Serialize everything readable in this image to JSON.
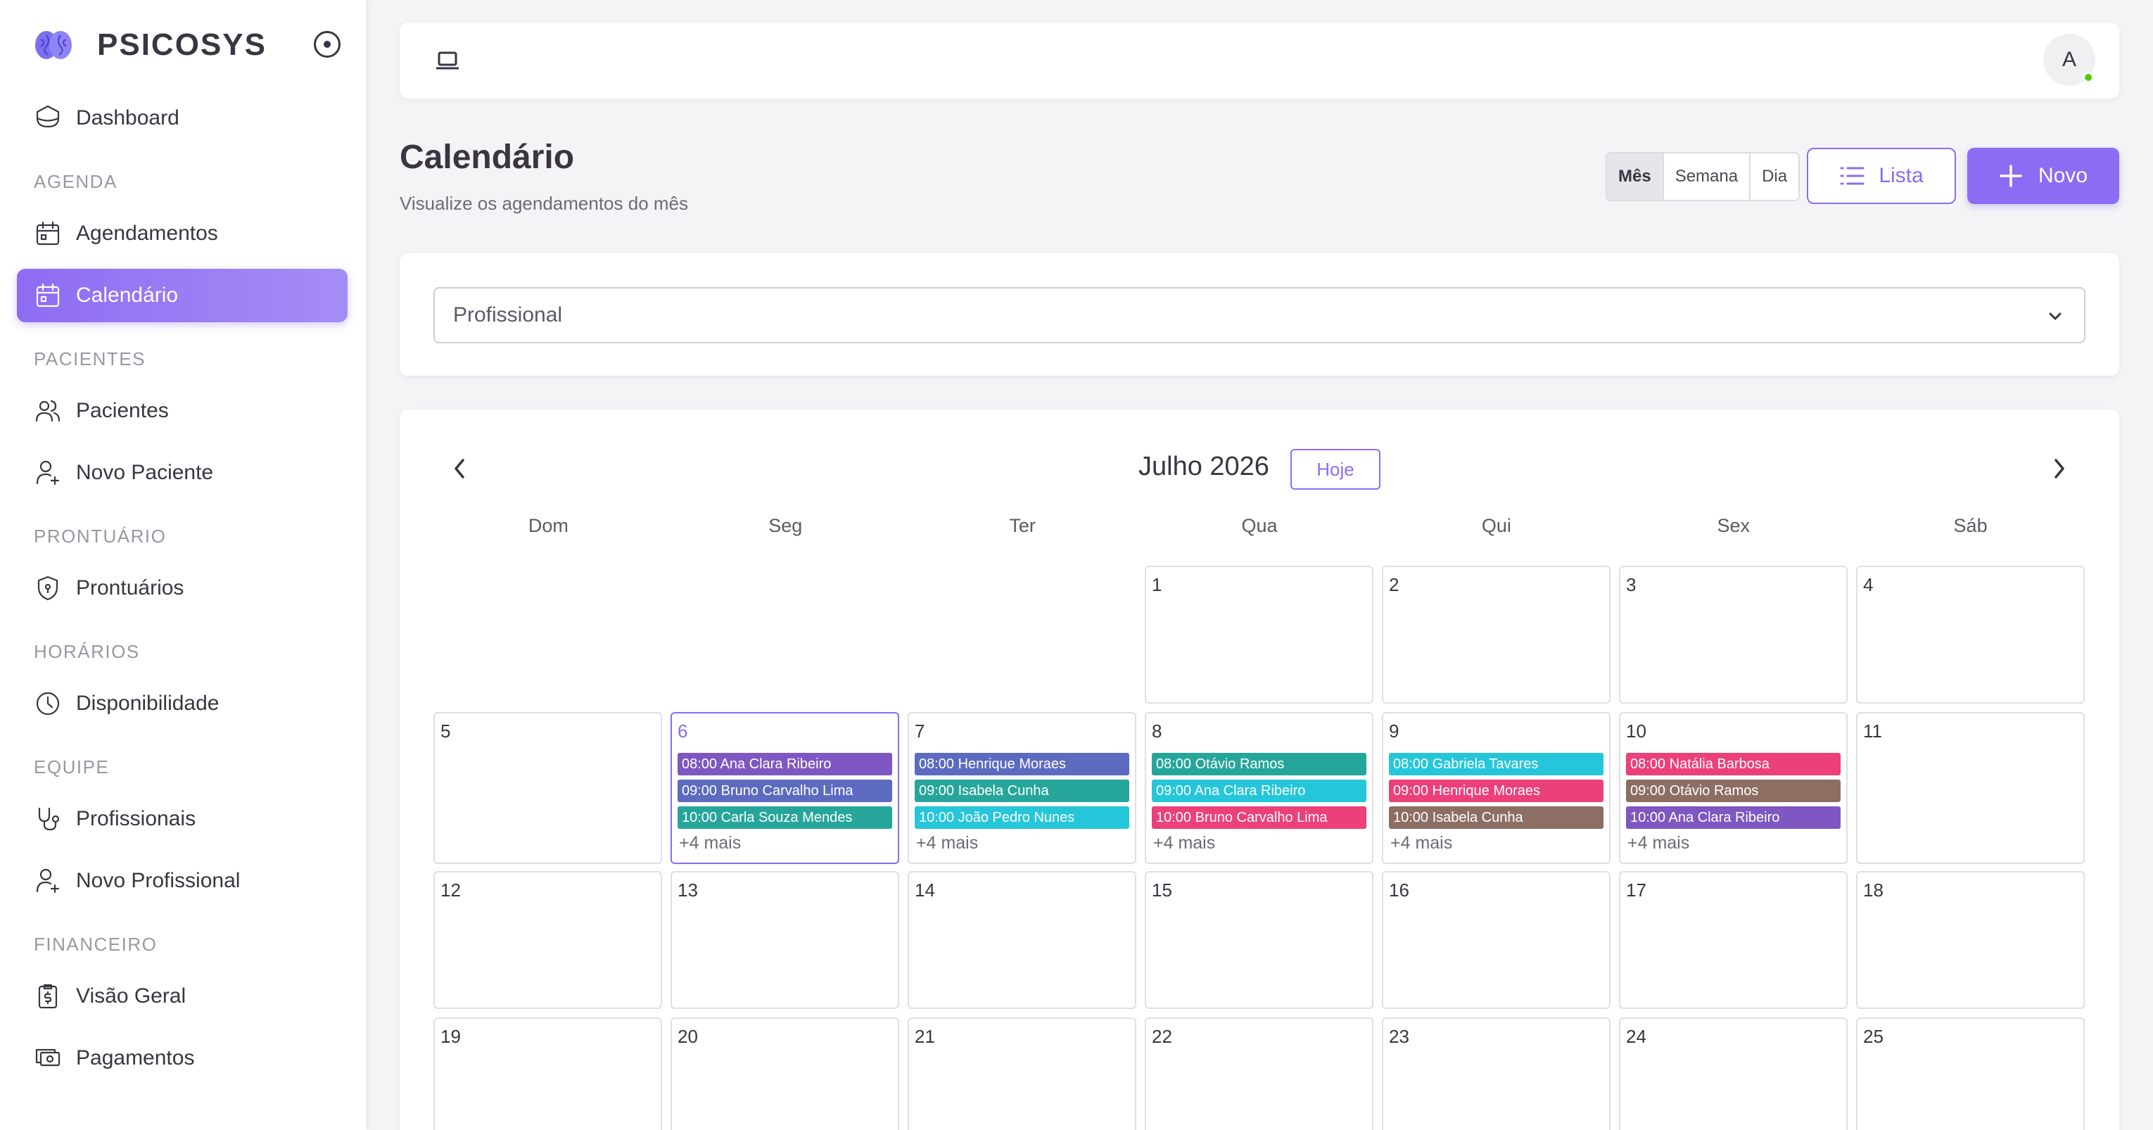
{
  "brand": {
    "name": "PSICOSYS"
  },
  "sidebar": {
    "items": [
      {
        "type": "item",
        "label": "Dashboard",
        "icon": "home-icon",
        "name": "sidebar-item-dashboard"
      },
      {
        "type": "section",
        "label": "AGENDA"
      },
      {
        "type": "item",
        "label": "Agendamentos",
        "icon": "calendar-check-icon",
        "name": "sidebar-item-agendamentos"
      },
      {
        "type": "item",
        "label": "Calendário",
        "icon": "calendar-icon",
        "name": "sidebar-item-calendario",
        "active": true
      },
      {
        "type": "section",
        "label": "PACIENTES"
      },
      {
        "type": "item",
        "label": "Pacientes",
        "icon": "users-icon",
        "name": "sidebar-item-pacientes"
      },
      {
        "type": "item",
        "label": "Novo Paciente",
        "icon": "user-plus-icon",
        "name": "sidebar-item-novo-paciente"
      },
      {
        "type": "section",
        "label": "PRONTUÁRIO"
      },
      {
        "type": "item",
        "label": "Prontuários",
        "icon": "shield-icon",
        "name": "sidebar-item-prontuarios"
      },
      {
        "type": "section",
        "label": "HORÁRIOS"
      },
      {
        "type": "item",
        "label": "Disponibilidade",
        "icon": "clock-icon",
        "name": "sidebar-item-disponibilidade"
      },
      {
        "type": "section",
        "label": "EQUIPE"
      },
      {
        "type": "item",
        "label": "Profissionais",
        "icon": "stethoscope-icon",
        "name": "sidebar-item-profissionais"
      },
      {
        "type": "item",
        "label": "Novo Profissional",
        "icon": "user-plus-icon",
        "name": "sidebar-item-novo-profissional"
      },
      {
        "type": "section",
        "label": "FINANCEIRO"
      },
      {
        "type": "item",
        "label": "Visão Geral",
        "icon": "report-money-icon",
        "name": "sidebar-item-visao-geral"
      },
      {
        "type": "item",
        "label": "Pagamentos",
        "icon": "cash-icon",
        "name": "sidebar-item-pagamentos"
      }
    ]
  },
  "topbar": {
    "avatar_initial": "A"
  },
  "page": {
    "title": "Calendário",
    "subtitle": "Visualize os agendamentos do mês",
    "view_modes": [
      "Mês",
      "Semana",
      "Dia"
    ],
    "selected_view": "Mês",
    "list_button": "Lista",
    "new_button": "Novo"
  },
  "filter": {
    "professional_placeholder": "Profissional"
  },
  "calendar": {
    "month_label": "Julho 2026",
    "today_button": "Hoje",
    "weekdays": [
      "Dom",
      "Seg",
      "Ter",
      "Qua",
      "Qui",
      "Sex",
      "Sáb"
    ],
    "today_day": 6,
    "weeks": [
      [
        null,
        null,
        null,
        1,
        2,
        3,
        4
      ],
      [
        5,
        6,
        7,
        8,
        9,
        10,
        11
      ],
      [
        12,
        13,
        14,
        15,
        16,
        17,
        18
      ],
      [
        19,
        20,
        21,
        22,
        23,
        24,
        25
      ]
    ],
    "events": {
      "6": {
        "items": [
          {
            "text": "08:00 Ana Clara Ribeiro",
            "color": "#7e57c2"
          },
          {
            "text": "09:00 Bruno Carvalho Lima",
            "color": "#5c6bc0"
          },
          {
            "text": "10:00 Carla Souza Mendes",
            "color": "#26a69a"
          }
        ],
        "more": "+4 mais"
      },
      "7": {
        "items": [
          {
            "text": "08:00 Henrique Moraes",
            "color": "#5c6bc0"
          },
          {
            "text": "09:00 Isabela Cunha",
            "color": "#26a69a"
          },
          {
            "text": "10:00 João Pedro Nunes",
            "color": "#26c6da"
          }
        ],
        "more": "+4 mais"
      },
      "8": {
        "items": [
          {
            "text": "08:00 Otávio Ramos",
            "color": "#26a69a"
          },
          {
            "text": "09:00 Ana Clara Ribeiro",
            "color": "#26c6da"
          },
          {
            "text": "10:00 Bruno Carvalho Lima",
            "color": "#ec407a"
          }
        ],
        "more": "+4 mais"
      },
      "9": {
        "items": [
          {
            "text": "08:00 Gabriela Tavares",
            "color": "#26c6da"
          },
          {
            "text": "09:00 Henrique Moraes",
            "color": "#ec407a"
          },
          {
            "text": "10:00 Isabela Cunha",
            "color": "#8d6e63"
          }
        ],
        "more": "+4 mais"
      },
      "10": {
        "items": [
          {
            "text": "08:00 Natália Barbosa",
            "color": "#ec407a"
          },
          {
            "text": "09:00 Otávio Ramos",
            "color": "#8d6e63"
          },
          {
            "text": "10:00 Ana Clara Ribeiro",
            "color": "#7e57c2"
          }
        ],
        "more": "+4 mais"
      }
    }
  },
  "colors": {
    "accent": "#8c6cf3",
    "online": "#56ca00"
  }
}
